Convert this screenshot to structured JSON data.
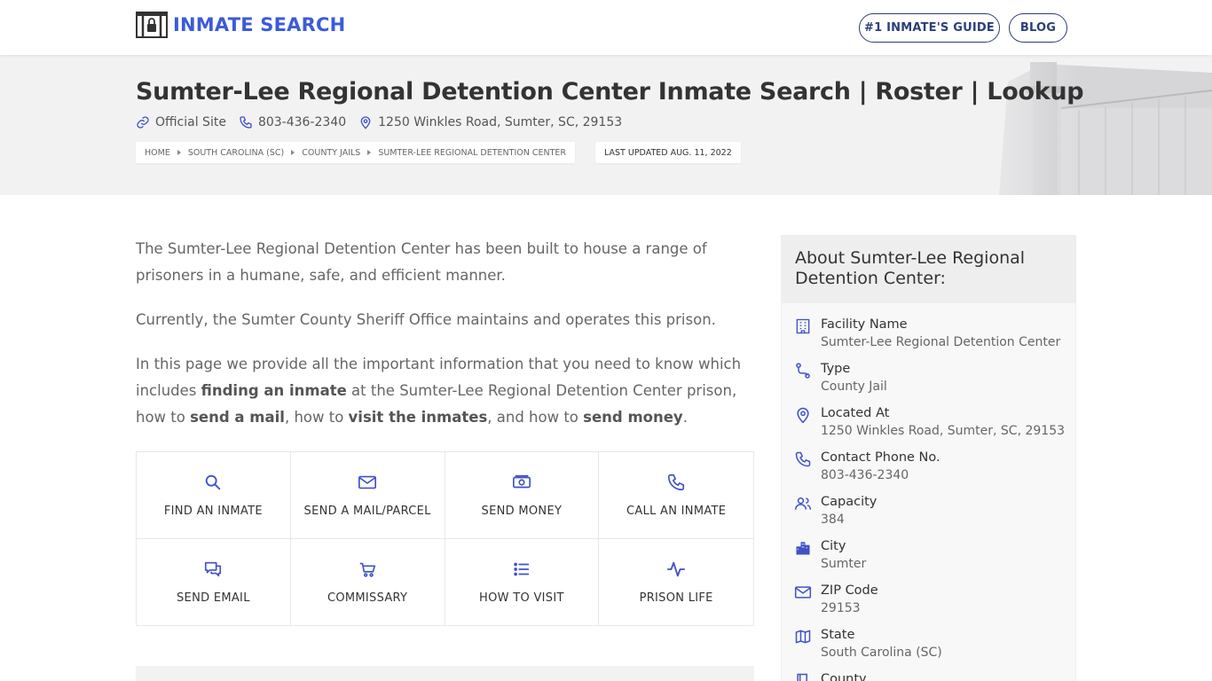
{
  "header": {
    "logo_text": "INMATE SEARCH",
    "nav": [
      {
        "label": "#1 INMATE'S GUIDE"
      },
      {
        "label": "BLOG"
      }
    ]
  },
  "hero": {
    "title": "Sumter-Lee Regional Detention Center Inmate Search | Roster | Lookup",
    "official_site": "Official Site",
    "phone": "803-436-2340",
    "address": "1250 Winkles Road, Sumter, SC, 29153",
    "breadcrumbs": [
      "HOME",
      "SOUTH CAROLINA (SC)",
      "COUNTY JAILS",
      "SUMTER-LEE REGIONAL DETENTION CENTER"
    ],
    "last_updated": "LAST UPDATED AUG. 11, 2022"
  },
  "intro": {
    "p1": "The Sumter-Lee Regional Detention Center has been built to house a range of prisoners in a humane, safe, and efficient manner.",
    "p2": "Currently, the Sumter County Sheriff Office maintains and operates this prison.",
    "p3_a": "In this page we provide all the important information that you need to know which includes ",
    "p3_b": "finding an inmate",
    "p3_c": " at the Sumter-Lee Regional Detention Center prison, how to ",
    "p3_d": "send a mail",
    "p3_e": ", how to ",
    "p3_f": "visit the inmates",
    "p3_g": ", and how to ",
    "p3_h": "send money",
    "p3_i": "."
  },
  "tiles": [
    {
      "label": "FIND AN INMATE",
      "icon": "search-icon"
    },
    {
      "label": "SEND A MAIL/PARCEL",
      "icon": "mail-icon"
    },
    {
      "label": "SEND MONEY",
      "icon": "money-icon"
    },
    {
      "label": "CALL AN INMATE",
      "icon": "phone-icon"
    },
    {
      "label": "SEND EMAIL",
      "icon": "chat-icon"
    },
    {
      "label": "COMMISSARY",
      "icon": "cart-icon"
    },
    {
      "label": "HOW TO VISIT",
      "icon": "list-icon"
    },
    {
      "label": "PRISON LIFE",
      "icon": "pulse-icon"
    }
  ],
  "sidebar": {
    "title": "About Sumter-Lee Regional Detention Center:",
    "items": [
      {
        "label": "Facility Name",
        "value": "Sumter-Lee Regional Detention Center",
        "icon": "building-icon"
      },
      {
        "label": "Type",
        "value": "County Jail",
        "icon": "route-icon"
      },
      {
        "label": "Located At",
        "value": "1250 Winkles Road, Sumter, SC, 29153",
        "icon": "location-pin-icon"
      },
      {
        "label": "Contact Phone No.",
        "value": "803-436-2340",
        "icon": "phone-icon"
      },
      {
        "label": "Capacity",
        "value": "384",
        "icon": "users-icon"
      },
      {
        "label": "City",
        "value": "Sumter",
        "icon": "city-icon"
      },
      {
        "label": "ZIP Code",
        "value": "29153",
        "icon": "mail-icon"
      },
      {
        "label": "State",
        "value": "South Carolina (SC)",
        "icon": "map-icon"
      },
      {
        "label": "County",
        "value": "",
        "icon": "book-icon"
      }
    ]
  },
  "colors": {
    "brand_blue": "#3b5bdb",
    "nav_border": "#2c3e7a",
    "icon_blue": "#3f51c8"
  }
}
